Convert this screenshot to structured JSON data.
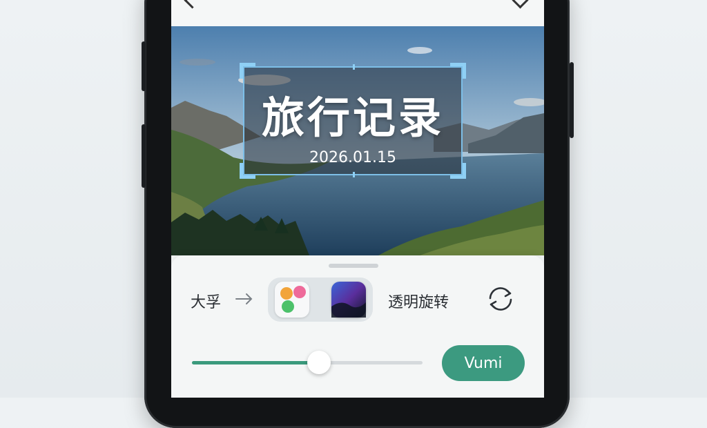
{
  "overlay": {
    "title": "旅行记录",
    "date": "2026.01.15"
  },
  "toolbar": {
    "left_label": "大孚",
    "right_label": "透明旋转",
    "arrow_icon": "arrow-right-icon",
    "rotate_icon": "rotate-icon"
  },
  "slider": {
    "value_fraction": 0.55
  },
  "apply_button": {
    "label": "Vumi"
  },
  "colors": {
    "accent": "#3c9a80",
    "selection": "#7dbfe8"
  }
}
